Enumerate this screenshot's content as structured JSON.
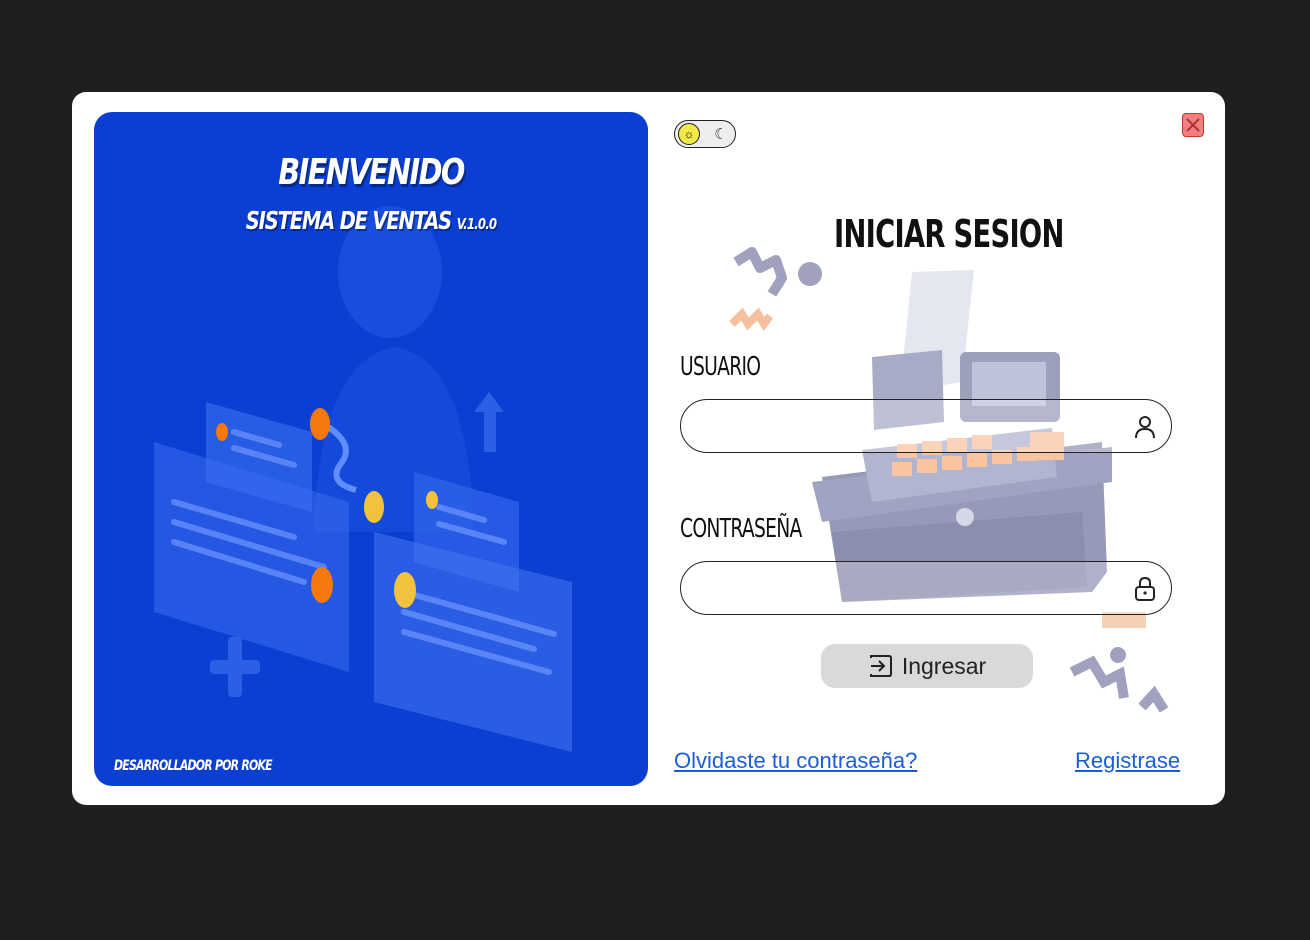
{
  "hero": {
    "title": "BIENVENIDO",
    "subtitle": "SISTEMA DE VENTAS",
    "version": "V.1.0.0",
    "footer": "DESARROLLADOR POR ROKE",
    "background_color": "#0a3fd1"
  },
  "theme_toggle": {
    "light_icon": "sun-icon",
    "dark_icon": "moon-icon",
    "active": "light"
  },
  "close_button": {
    "icon": "close-icon",
    "color": "#f08080"
  },
  "login": {
    "title": "INICIAR SESION",
    "username_label": "USUARIO",
    "username_value": "",
    "username_icon": "user-icon",
    "password_label": "CONTRASEÑA",
    "password_value": "",
    "password_icon": "lock-icon",
    "submit_label": "Ingresar",
    "submit_icon": "login-icon"
  },
  "links": {
    "forgot_password": "Olvidaste tu contraseña?",
    "register": "Registrase",
    "color": "#1a5ddb"
  }
}
